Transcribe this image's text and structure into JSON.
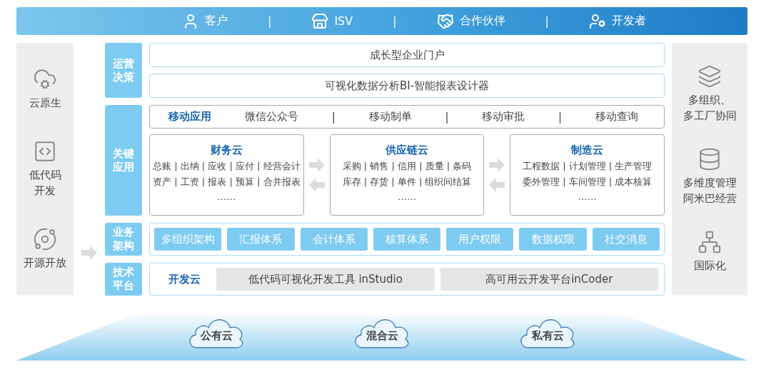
{
  "audience_bar": {
    "items": [
      {
        "label": "客户",
        "kind": "customer"
      },
      {
        "label": "ISV",
        "kind": "store"
      },
      {
        "label": "合作伙伴",
        "kind": "partner"
      },
      {
        "label": "开发者",
        "kind": "developer"
      }
    ],
    "separators": [
      "|",
      "|",
      "|"
    ]
  },
  "left_panel": [
    {
      "lines": [
        "云原生"
      ],
      "kind": "cloud"
    },
    {
      "lines": [
        "低代码",
        "开发"
      ],
      "kind": "code"
    },
    {
      "lines": [
        "开源开放"
      ],
      "kind": "open"
    }
  ],
  "operations": {
    "label": "运营决策",
    "items": [
      "成长型企业门户",
      "可视化数据分析BI-智能报表设计器"
    ]
  },
  "key_apps": {
    "label": "关键应用",
    "mobile": {
      "title": "移动应用",
      "items": [
        "微信公众号",
        "移动制单",
        "移动审批",
        "移动查询"
      ],
      "separators": [
        "|",
        "|",
        "|"
      ]
    },
    "clouds": [
      {
        "title": "财务云",
        "lines": [
          "总账 | 出纳 | 应收 | 应付 | 经营会计",
          "资产 | 工资 | 报表 | 预算 | 合并报表"
        ],
        "more": "……"
      },
      {
        "title": "供应链云",
        "lines": [
          "采购 | 销售 | 信用 | 质量 | 条码",
          "库存 | 存货 | 单件 | 组织间结算"
        ],
        "more": "……"
      },
      {
        "title": "制造云",
        "lines": [
          "工程数据 | 计划管理 | 生产管理",
          "委外管理 | 车间管理 | 成本核算"
        ],
        "more": "……"
      }
    ]
  },
  "business": {
    "label": "业务架构",
    "items": [
      "多组织架构",
      "汇报体系",
      "会计体系",
      "核算体系",
      "用户权限",
      "数据权限",
      "社交消息"
    ]
  },
  "tech": {
    "label": "技术平台",
    "title": "开发云",
    "tools": [
      "低代码可视化开发工具 inStudio",
      "高可用云开发平台inCoder"
    ]
  },
  "right_panel": [
    {
      "lines": [
        "多组织、",
        "多工厂协同"
      ],
      "kind": "layers"
    },
    {
      "lines": [
        "多维度管理",
        "阿米巴经营"
      ],
      "kind": "database"
    },
    {
      "lines": [
        "国际化"
      ],
      "kind": "global"
    }
  ],
  "deployment": [
    "公有云",
    "混合云",
    "私有云"
  ]
}
